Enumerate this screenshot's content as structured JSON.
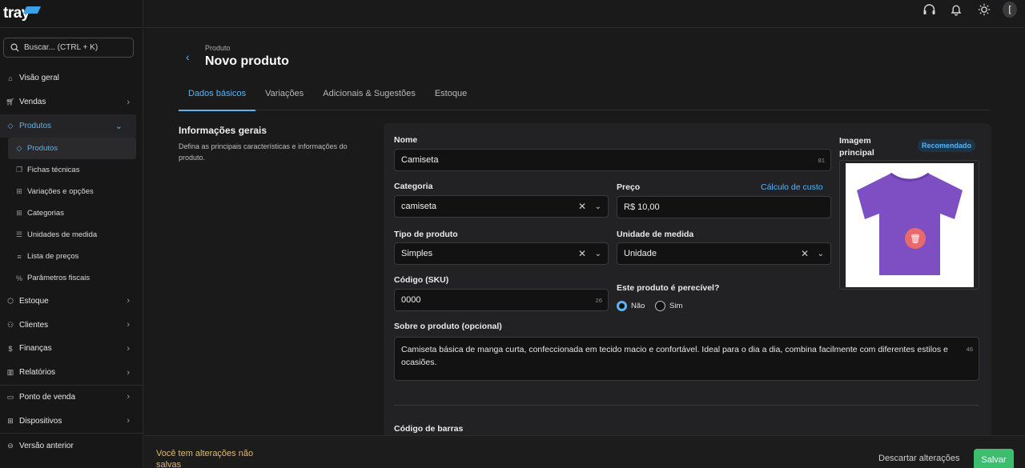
{
  "brand": {
    "logo_text": "tray"
  },
  "search": {
    "placeholder": "Buscar... (CTRL + K)"
  },
  "sidebar": {
    "items": [
      {
        "label": "Visão geral",
        "icon": "home-icon"
      },
      {
        "label": "Vendas",
        "icon": "cart-icon"
      },
      {
        "label": "Produtos",
        "icon": "tag-icon"
      },
      {
        "label": "Estoque",
        "icon": "box-icon"
      },
      {
        "label": "Clientes",
        "icon": "users-icon"
      },
      {
        "label": "Finanças",
        "icon": "dollar-icon"
      },
      {
        "label": "Relatórios",
        "icon": "chart-icon"
      },
      {
        "label": "Ponto de venda",
        "icon": "monitor-icon"
      },
      {
        "label": "Dispositivos",
        "icon": "grid-icon"
      },
      {
        "label": "Versão anterior",
        "icon": "history-icon"
      }
    ],
    "sub_items": [
      {
        "label": "Produtos",
        "icon": "tag-icon"
      },
      {
        "label": "Fichas técnicas",
        "icon": "copy-icon"
      },
      {
        "label": "Variações e opções",
        "icon": "grid-icon"
      },
      {
        "label": "Categorias",
        "icon": "category-icon"
      },
      {
        "label": "Unidades de medida",
        "icon": "database-icon"
      },
      {
        "label": "Lista de preços",
        "icon": "list-icon"
      },
      {
        "label": "Parâmetros fiscais",
        "icon": "percent-icon"
      }
    ]
  },
  "header": {
    "breadcrumb": "Produto",
    "title": "Novo produto"
  },
  "tabs": [
    "Dados básicos",
    "Variações",
    "Adicionais & Sugestões",
    "Estoque"
  ],
  "section": {
    "title": "Informações gerais",
    "description": "Defina as principais características e informações do produto."
  },
  "form": {
    "name_label": "Nome",
    "name_value": "Camiseta",
    "name_counter": "81",
    "category_label": "Categoria",
    "category_value": "camiseta",
    "price_label": "Preço",
    "price_link": "Cálculo de custo",
    "price_value": "R$ 10,00",
    "type_label": "Tipo de produto",
    "type_value": "Simples",
    "unit_label": "Unidade de medida",
    "unit_value": "Unidade",
    "sku_label": "Código (SKU)",
    "sku_value": "0000",
    "sku_counter": "26",
    "perishable_label": "Este produto é perecível?",
    "perishable_no": "Não",
    "perishable_yes": "Sim",
    "perishable_selected": "Não",
    "about_label": "Sobre o produto (opcional)",
    "about_value": "Camiseta básica de manga curta, confeccionada em tecido macio e confortável. Ideal para o dia a dia, combina facilmente com diferentes estilos e ocasiões.",
    "about_counter": "46",
    "barcode_label": "Código de barras",
    "image_label": "Imagem principal",
    "image_badge": "Recomendado"
  },
  "footer": {
    "unsaved_text": "Você tem alterações não salvas",
    "discard_label": "Descartar alterações",
    "save_label": "Salvar"
  },
  "colors": {
    "accent": "#5eb3f0",
    "save": "#3dbd6e",
    "warning_text": "#e0b974",
    "tshirt": "#7e4fc2"
  },
  "topbar": {
    "avatar_initial": "["
  }
}
